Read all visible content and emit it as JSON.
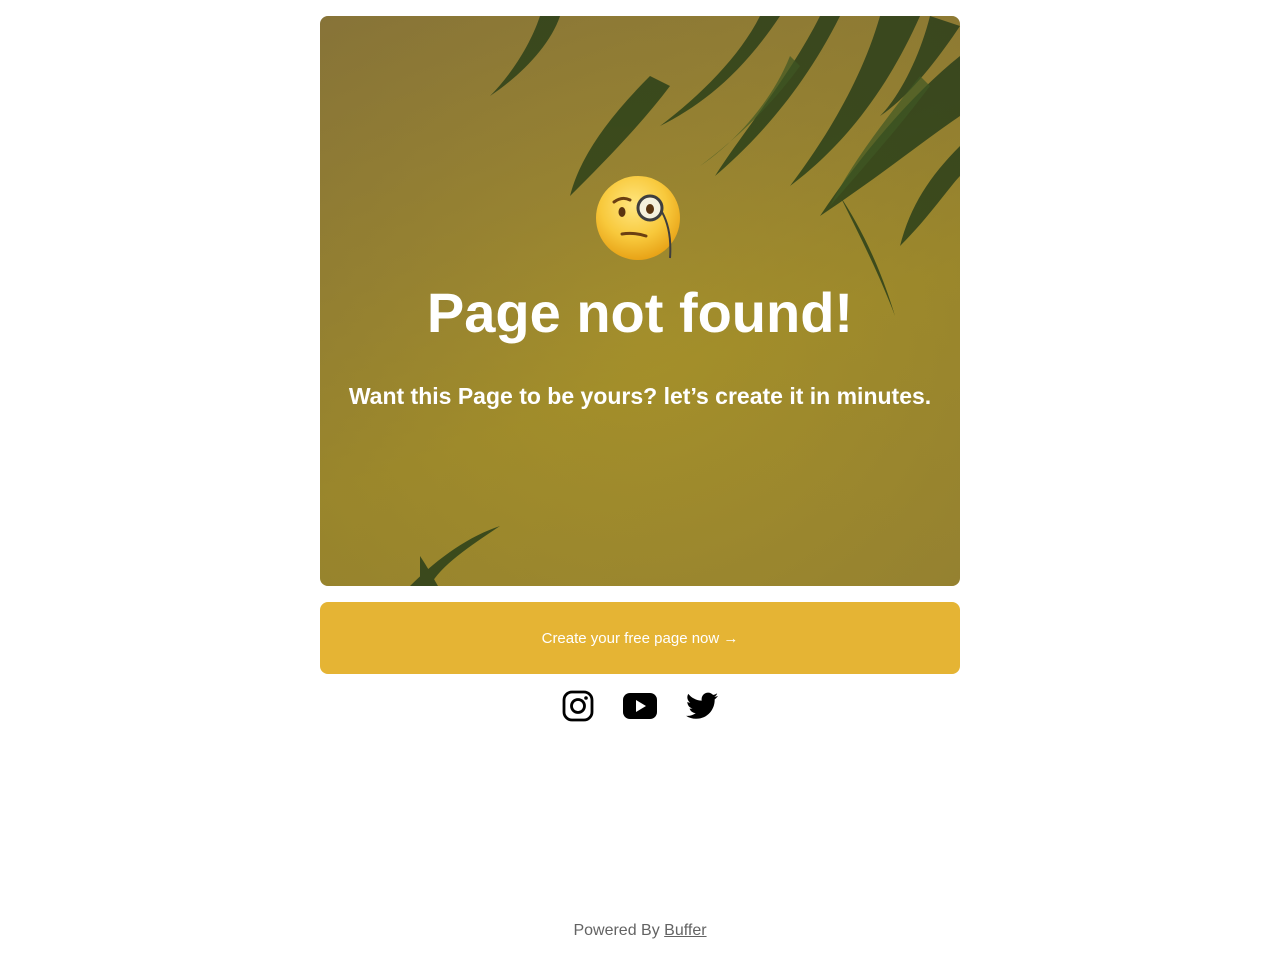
{
  "hero": {
    "emoji_icon": "face-with-monocle-icon",
    "title": "Page not found!",
    "subtitle": "Want this Page to be yours? let’s create it in minutes."
  },
  "cta": {
    "label": "Create your free page now →",
    "color": "#e5b434"
  },
  "socials": [
    {
      "name": "instagram-icon"
    },
    {
      "name": "youtube-icon"
    },
    {
      "name": "twitter-icon"
    }
  ],
  "footer": {
    "prefix": "Powered By",
    "link": "Buffer"
  }
}
